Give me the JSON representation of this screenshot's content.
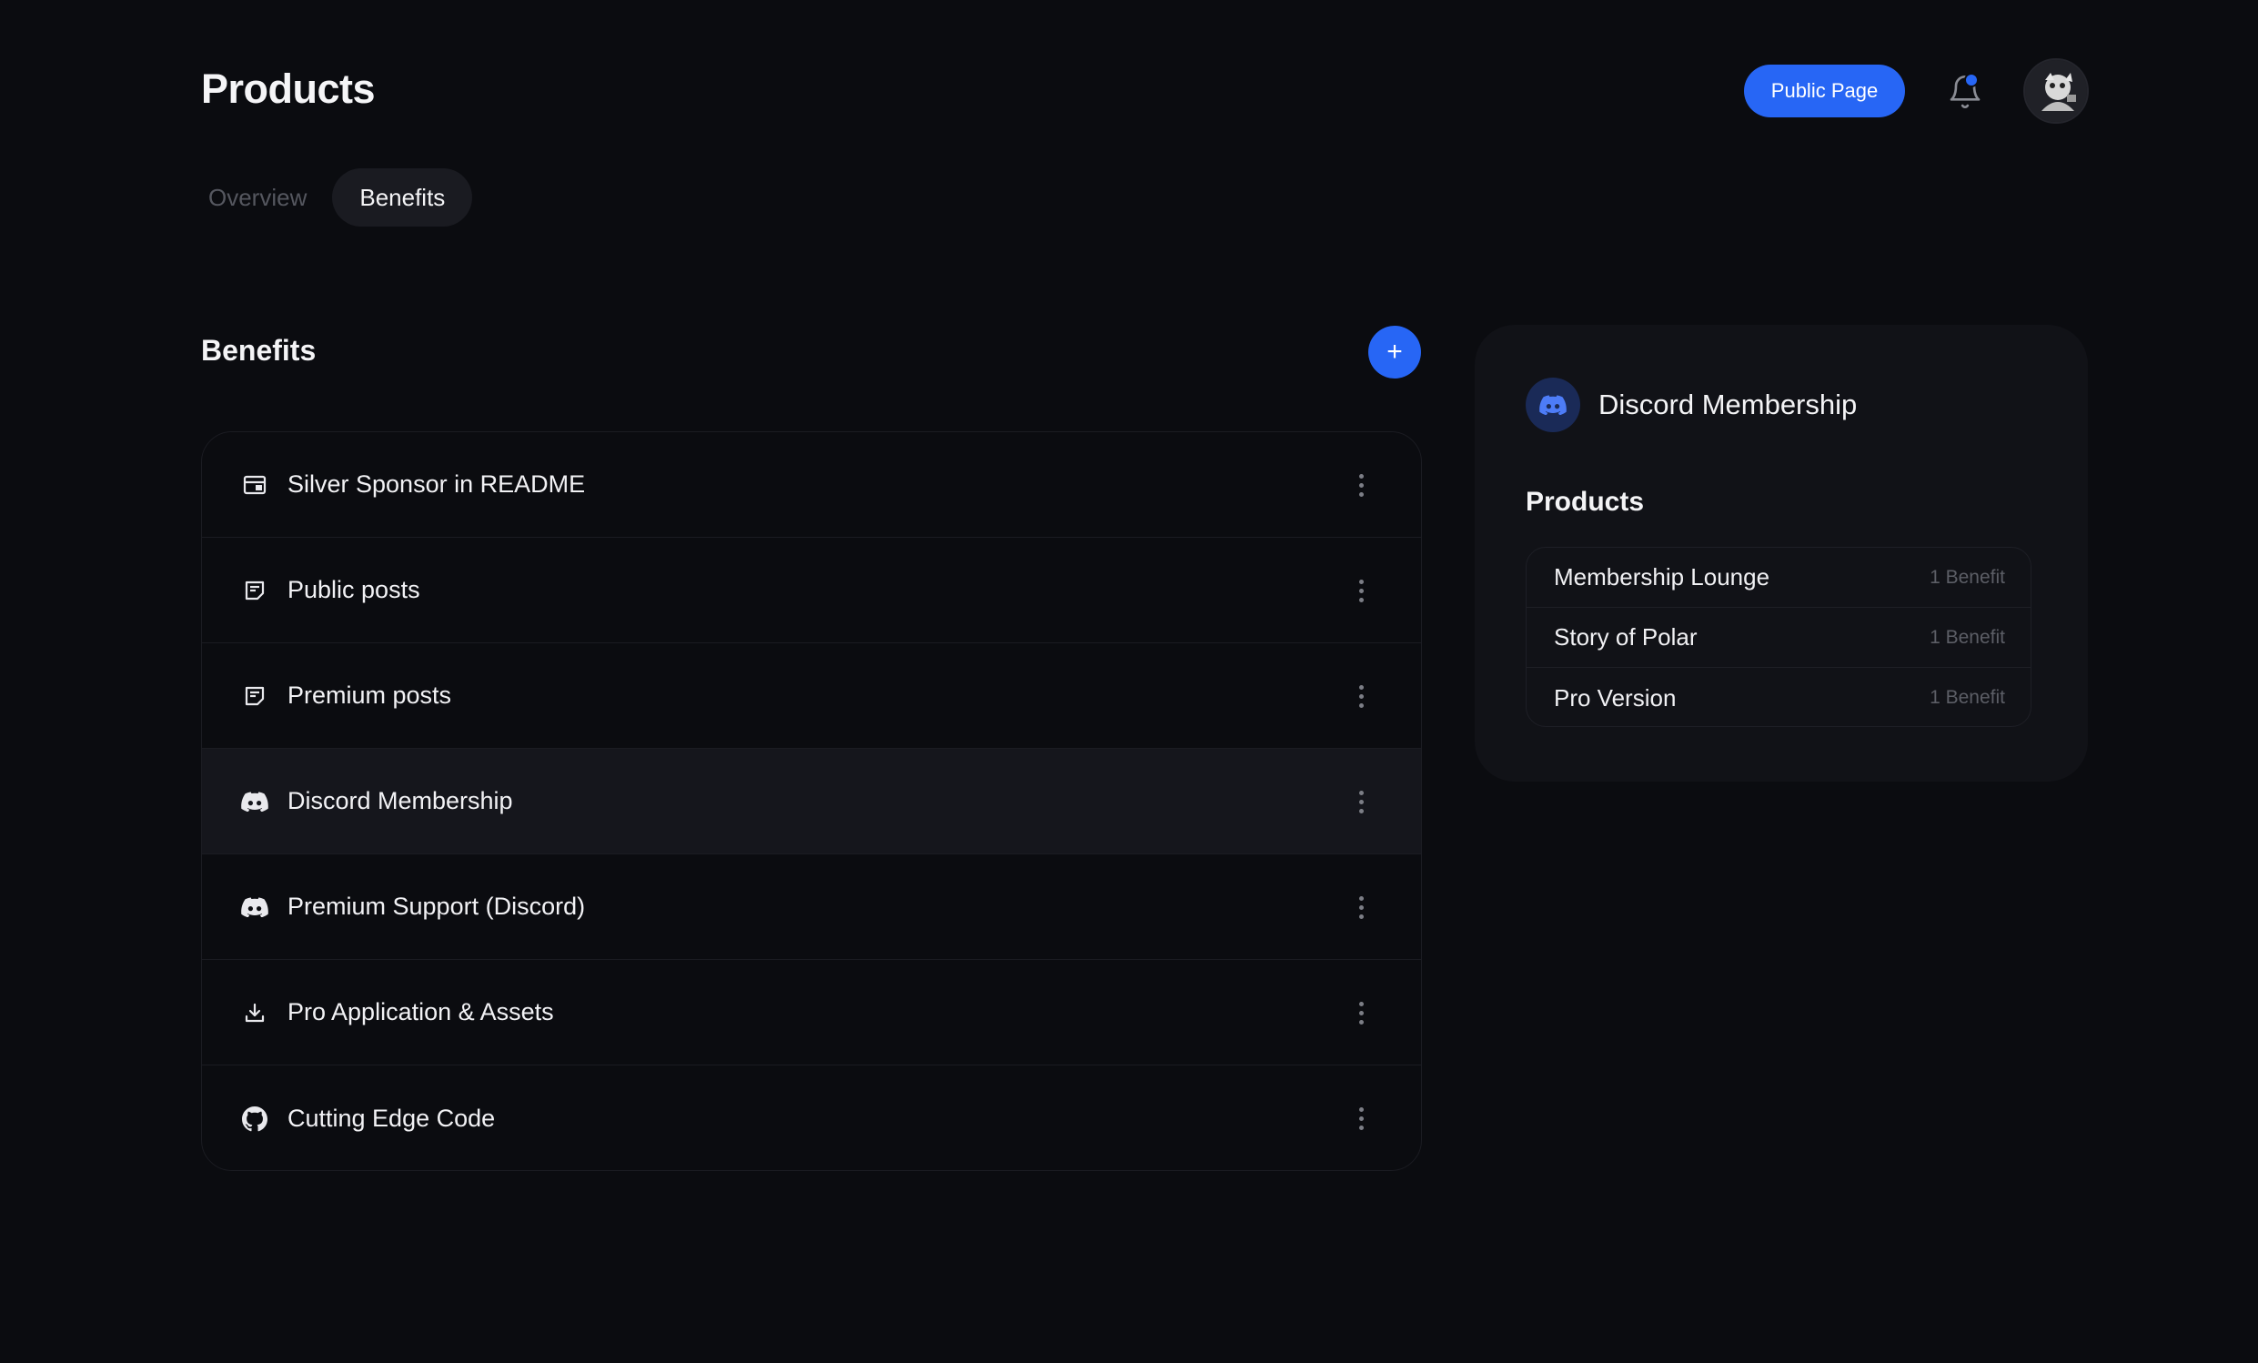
{
  "header": {
    "title": "Products",
    "public_page_label": "Public Page",
    "has_notification": true
  },
  "tabs": [
    {
      "label": "Overview",
      "active": false
    },
    {
      "label": "Benefits",
      "active": true
    }
  ],
  "benefits": {
    "title": "Benefits",
    "add_label": "+",
    "items": [
      {
        "label": "Silver Sponsor in README",
        "icon": "ad-card-icon",
        "selected": false
      },
      {
        "label": "Public posts",
        "icon": "note-icon",
        "selected": false
      },
      {
        "label": "Premium posts",
        "icon": "note-icon",
        "selected": false
      },
      {
        "label": "Discord Membership",
        "icon": "discord-icon",
        "selected": true
      },
      {
        "label": "Premium Support (Discord)",
        "icon": "discord-icon",
        "selected": false
      },
      {
        "label": "Pro Application & Assets",
        "icon": "download-icon",
        "selected": false
      },
      {
        "label": "Cutting Edge Code",
        "icon": "github-icon",
        "selected": false
      }
    ]
  },
  "detail": {
    "title": "Discord Membership",
    "icon": "discord-icon",
    "products_heading": "Products",
    "products": [
      {
        "name": "Membership Lounge",
        "count": "1 Benefit"
      },
      {
        "name": "Story of Polar",
        "count": "1 Benefit"
      },
      {
        "name": "Pro Version",
        "count": "1 Benefit"
      }
    ]
  },
  "colors": {
    "background": "#0b0c10",
    "accent": "#2766f5",
    "panel": "#111217",
    "muted_text": "#5c5e66"
  }
}
